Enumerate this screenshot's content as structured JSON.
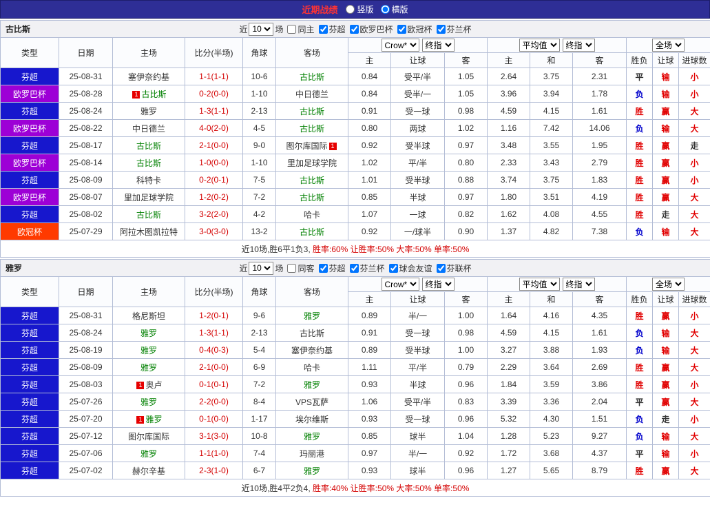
{
  "header": {
    "title": "近期战绩",
    "radios": [
      {
        "label": "竖版",
        "checked": false
      },
      {
        "label": "横版",
        "checked": true
      }
    ]
  },
  "controls": {
    "near": "近",
    "count": "10",
    "games": "场",
    "odds_source": "Crow*",
    "final_odds": "终指",
    "average": "平均值",
    "full_time": "全场"
  },
  "columns": {
    "main": [
      "类型",
      "日期",
      "主场",
      "比分(半场)",
      "角球",
      "客场"
    ],
    "sub": [
      "主",
      "让球",
      "客",
      "主",
      "和",
      "客",
      "胜负",
      "让球",
      "进球数"
    ]
  },
  "league_colors": {
    "芬超": "#1717cd",
    "欧罗巴杯": "#9d00d6",
    "欧冠杯": "#ff3a00"
  },
  "result_colors": {
    "r": "#e10000",
    "b": "#0000cc",
    "k": "#333333"
  },
  "colors": {
    "topbar_bg": "#2e2e96",
    "title_text": "#ff3333",
    "score_text": "#d40000",
    "focal_team": "#008000",
    "opponent_team": "#333333",
    "summary_stats": "#d40000",
    "grid_border": "#b3bdd6",
    "red_card": "#e60000"
  },
  "sections": [
    {
      "team": "古比斯",
      "venue_filter": {
        "label": "同主",
        "checked": false
      },
      "league_filters": [
        {
          "label": "芬超",
          "checked": true
        },
        {
          "label": "欧罗巴杯",
          "checked": true
        },
        {
          "label": "欧冠杯",
          "checked": true
        },
        {
          "label": "芬兰杯",
          "checked": true
        }
      ],
      "rows": [
        {
          "league": "芬超",
          "date": "25-08-31",
          "home": {
            "name": "塞伊奈约基"
          },
          "score": "1-1(1-1)",
          "corners": "10-6",
          "away": {
            "name": "古比斯",
            "focal": true
          },
          "odds": [
            "0.84",
            "受平/半",
            "1.05"
          ],
          "avg": [
            "2.64",
            "3.75",
            "2.31"
          ],
          "results": [
            [
              "平",
              "k"
            ],
            [
              "输",
              "r"
            ],
            [
              "小",
              "r"
            ]
          ]
        },
        {
          "league": "欧罗巴杯",
          "date": "25-08-28",
          "home": {
            "name": "古比斯",
            "focal": true,
            "rc": "1",
            "rc_pos": "left"
          },
          "score": "0-2(0-0)",
          "corners": "1-10",
          "away": {
            "name": "中日德兰"
          },
          "odds": [
            "0.84",
            "受半/一",
            "1.05"
          ],
          "avg": [
            "3.96",
            "3.94",
            "1.78"
          ],
          "results": [
            [
              "负",
              "b"
            ],
            [
              "输",
              "r"
            ],
            [
              "小",
              "r"
            ]
          ]
        },
        {
          "league": "芬超",
          "date": "25-08-24",
          "home": {
            "name": "雅罗"
          },
          "score": "1-3(1-1)",
          "corners": "2-13",
          "away": {
            "name": "古比斯",
            "focal": true
          },
          "odds": [
            "0.91",
            "受一球",
            "0.98"
          ],
          "avg": [
            "4.59",
            "4.15",
            "1.61"
          ],
          "results": [
            [
              "胜",
              "r"
            ],
            [
              "赢",
              "r"
            ],
            [
              "大",
              "r"
            ]
          ]
        },
        {
          "league": "欧罗巴杯",
          "date": "25-08-22",
          "home": {
            "name": "中日德兰"
          },
          "score": "4-0(2-0)",
          "corners": "4-5",
          "away": {
            "name": "古比斯",
            "focal": true
          },
          "odds": [
            "0.80",
            "两球",
            "1.02"
          ],
          "avg": [
            "1.16",
            "7.42",
            "14.06"
          ],
          "results": [
            [
              "负",
              "b"
            ],
            [
              "输",
              "r"
            ],
            [
              "大",
              "r"
            ]
          ]
        },
        {
          "league": "芬超",
          "date": "25-08-17",
          "home": {
            "name": "古比斯",
            "focal": true
          },
          "score": "2-1(0-0)",
          "corners": "9-0",
          "away": {
            "name": "图尔库国际",
            "rc": "1",
            "rc_pos": "right"
          },
          "odds": [
            "0.92",
            "受半球",
            "0.97"
          ],
          "avg": [
            "3.48",
            "3.55",
            "1.95"
          ],
          "results": [
            [
              "胜",
              "r"
            ],
            [
              "赢",
              "r"
            ],
            [
              "走",
              "k"
            ]
          ]
        },
        {
          "league": "欧罗巴杯",
          "date": "25-08-14",
          "home": {
            "name": "古比斯",
            "focal": true
          },
          "score": "1-0(0-0)",
          "corners": "1-10",
          "away": {
            "name": "里加足球学院"
          },
          "odds": [
            "1.02",
            "平/半",
            "0.80"
          ],
          "avg": [
            "2.33",
            "3.43",
            "2.79"
          ],
          "results": [
            [
              "胜",
              "r"
            ],
            [
              "赢",
              "r"
            ],
            [
              "小",
              "r"
            ]
          ]
        },
        {
          "league": "芬超",
          "date": "25-08-09",
          "home": {
            "name": "科特卡"
          },
          "score": "0-2(0-1)",
          "corners": "7-5",
          "away": {
            "name": "古比斯",
            "focal": true
          },
          "odds": [
            "1.01",
            "受半球",
            "0.88"
          ],
          "avg": [
            "3.74",
            "3.75",
            "1.83"
          ],
          "results": [
            [
              "胜",
              "r"
            ],
            [
              "赢",
              "r"
            ],
            [
              "小",
              "r"
            ]
          ]
        },
        {
          "league": "欧罗巴杯",
          "date": "25-08-07",
          "home": {
            "name": "里加足球学院"
          },
          "score": "1-2(0-2)",
          "corners": "7-2",
          "away": {
            "name": "古比斯",
            "focal": true
          },
          "odds": [
            "0.85",
            "半球",
            "0.97"
          ],
          "avg": [
            "1.80",
            "3.51",
            "4.19"
          ],
          "results": [
            [
              "胜",
              "r"
            ],
            [
              "赢",
              "r"
            ],
            [
              "大",
              "r"
            ]
          ]
        },
        {
          "league": "芬超",
          "date": "25-08-02",
          "home": {
            "name": "古比斯",
            "focal": true
          },
          "score": "3-2(2-0)",
          "corners": "4-2",
          "away": {
            "name": "哈卡"
          },
          "odds": [
            "1.07",
            "一球",
            "0.82"
          ],
          "avg": [
            "1.62",
            "4.08",
            "4.55"
          ],
          "results": [
            [
              "胜",
              "r"
            ],
            [
              "走",
              "k"
            ],
            [
              "大",
              "r"
            ]
          ]
        },
        {
          "league": "欧冠杯",
          "date": "25-07-29",
          "home": {
            "name": "阿拉木图凯拉特"
          },
          "score": "3-0(3-0)",
          "corners": "13-2",
          "away": {
            "name": "古比斯",
            "focal": true
          },
          "odds": [
            "0.92",
            "一/球半",
            "0.90"
          ],
          "avg": [
            "1.37",
            "4.82",
            "7.38"
          ],
          "results": [
            [
              "负",
              "b"
            ],
            [
              "输",
              "r"
            ],
            [
              "大",
              "r"
            ]
          ]
        }
      ],
      "summary": {
        "prefix": "近10场,胜6平1负3,",
        "stats": "胜率:60% 让胜率:50% 大率:50% 单率:50%"
      }
    },
    {
      "team": "雅罗",
      "venue_filter": {
        "label": "同客",
        "checked": false
      },
      "league_filters": [
        {
          "label": "芬超",
          "checked": true
        },
        {
          "label": "芬兰杯",
          "checked": true
        },
        {
          "label": "球会友谊",
          "checked": true
        },
        {
          "label": "芬联杯",
          "checked": true
        }
      ],
      "rows": [
        {
          "league": "芬超",
          "date": "25-08-31",
          "home": {
            "name": "格尼斯坦"
          },
          "score": "1-2(0-1)",
          "corners": "9-6",
          "away": {
            "name": "雅罗",
            "focal": true
          },
          "odds": [
            "0.89",
            "半/一",
            "1.00"
          ],
          "avg": [
            "1.64",
            "4.16",
            "4.35"
          ],
          "results": [
            [
              "胜",
              "r"
            ],
            [
              "赢",
              "r"
            ],
            [
              "小",
              "r"
            ]
          ]
        },
        {
          "league": "芬超",
          "date": "25-08-24",
          "home": {
            "name": "雅罗",
            "focal": true
          },
          "score": "1-3(1-1)",
          "corners": "2-13",
          "away": {
            "name": "古比斯"
          },
          "odds": [
            "0.91",
            "受一球",
            "0.98"
          ],
          "avg": [
            "4.59",
            "4.15",
            "1.61"
          ],
          "results": [
            [
              "负",
              "b"
            ],
            [
              "输",
              "r"
            ],
            [
              "大",
              "r"
            ]
          ]
        },
        {
          "league": "芬超",
          "date": "25-08-19",
          "home": {
            "name": "雅罗",
            "focal": true
          },
          "score": "0-4(0-3)",
          "corners": "5-4",
          "away": {
            "name": "塞伊奈约基"
          },
          "odds": [
            "0.89",
            "受半球",
            "1.00"
          ],
          "avg": [
            "3.27",
            "3.88",
            "1.93"
          ],
          "results": [
            [
              "负",
              "b"
            ],
            [
              "输",
              "r"
            ],
            [
              "大",
              "r"
            ]
          ]
        },
        {
          "league": "芬超",
          "date": "25-08-09",
          "home": {
            "name": "雅罗",
            "focal": true
          },
          "score": "2-1(0-0)",
          "corners": "6-9",
          "away": {
            "name": "哈卡"
          },
          "odds": [
            "1.11",
            "平/半",
            "0.79"
          ],
          "avg": [
            "2.29",
            "3.64",
            "2.69"
          ],
          "results": [
            [
              "胜",
              "r"
            ],
            [
              "赢",
              "r"
            ],
            [
              "大",
              "r"
            ]
          ]
        },
        {
          "league": "芬超",
          "date": "25-08-03",
          "home": {
            "name": "奥卢",
            "rc": "1",
            "rc_pos": "left"
          },
          "score": "0-1(0-1)",
          "corners": "7-2",
          "away": {
            "name": "雅罗",
            "focal": true
          },
          "odds": [
            "0.93",
            "半球",
            "0.96"
          ],
          "avg": [
            "1.84",
            "3.59",
            "3.86"
          ],
          "results": [
            [
              "胜",
              "r"
            ],
            [
              "赢",
              "r"
            ],
            [
              "小",
              "r"
            ]
          ]
        },
        {
          "league": "芬超",
          "date": "25-07-26",
          "home": {
            "name": "雅罗",
            "focal": true
          },
          "score": "2-2(0-0)",
          "corners": "8-4",
          "away": {
            "name": "VPS瓦萨"
          },
          "odds": [
            "1.06",
            "受平/半",
            "0.83"
          ],
          "avg": [
            "3.39",
            "3.36",
            "2.04"
          ],
          "results": [
            [
              "平",
              "k"
            ],
            [
              "赢",
              "r"
            ],
            [
              "大",
              "r"
            ]
          ]
        },
        {
          "league": "芬超",
          "date": "25-07-20",
          "home": {
            "name": "雅罗",
            "focal": true,
            "rc": "1",
            "rc_pos": "left"
          },
          "score": "0-1(0-0)",
          "corners": "1-17",
          "away": {
            "name": "埃尔维斯"
          },
          "odds": [
            "0.93",
            "受一球",
            "0.96"
          ],
          "avg": [
            "5.32",
            "4.30",
            "1.51"
          ],
          "results": [
            [
              "负",
              "b"
            ],
            [
              "走",
              "k"
            ],
            [
              "小",
              "r"
            ]
          ]
        },
        {
          "league": "芬超",
          "date": "25-07-12",
          "home": {
            "name": "图尔库国际"
          },
          "score": "3-1(3-0)",
          "corners": "10-8",
          "away": {
            "name": "雅罗",
            "focal": true
          },
          "odds": [
            "0.85",
            "球半",
            "1.04"
          ],
          "avg": [
            "1.28",
            "5.23",
            "9.27"
          ],
          "results": [
            [
              "负",
              "b"
            ],
            [
              "输",
              "r"
            ],
            [
              "大",
              "r"
            ]
          ]
        },
        {
          "league": "芬超",
          "date": "25-07-06",
          "home": {
            "name": "雅罗",
            "focal": true
          },
          "score": "1-1(1-0)",
          "corners": "7-4",
          "away": {
            "name": "玛丽港"
          },
          "odds": [
            "0.97",
            "半/一",
            "0.92"
          ],
          "avg": [
            "1.72",
            "3.68",
            "4.37"
          ],
          "results": [
            [
              "平",
              "k"
            ],
            [
              "输",
              "r"
            ],
            [
              "小",
              "r"
            ]
          ]
        },
        {
          "league": "芬超",
          "date": "25-07-02",
          "home": {
            "name": "赫尔辛基"
          },
          "score": "2-3(1-0)",
          "corners": "6-7",
          "away": {
            "name": "雅罗",
            "focal": true
          },
          "odds": [
            "0.93",
            "球半",
            "0.96"
          ],
          "avg": [
            "1.27",
            "5.65",
            "8.79"
          ],
          "results": [
            [
              "胜",
              "r"
            ],
            [
              "赢",
              "r"
            ],
            [
              "大",
              "r"
            ]
          ]
        }
      ],
      "summary": {
        "prefix": "近10场,胜4平2负4,",
        "stats": "胜率:40% 让胜率:50% 大率:50% 单率:50%"
      }
    }
  ]
}
